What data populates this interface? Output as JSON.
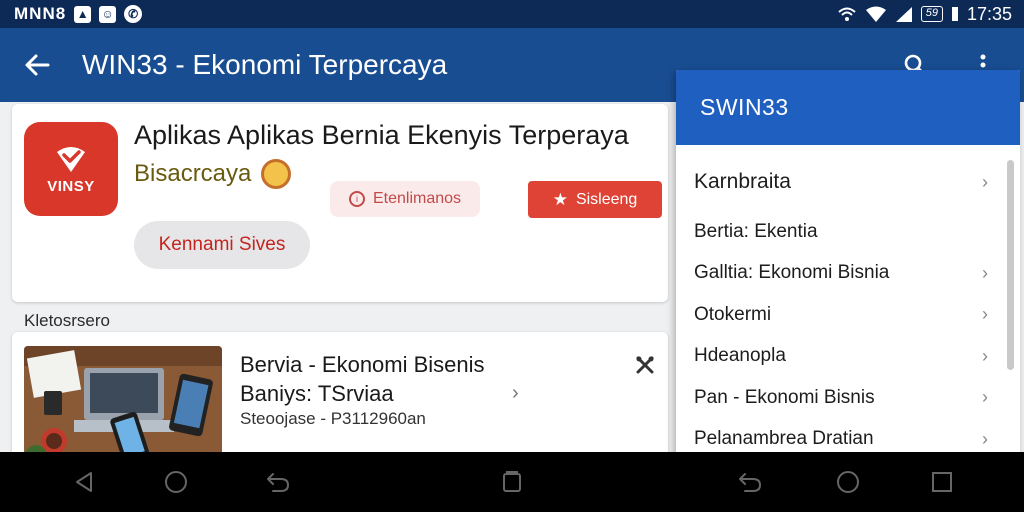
{
  "status_bar": {
    "carrier": "MNN8",
    "time": "17:35",
    "battery": "59",
    "left_icons": [
      "image-icon",
      "game-icon",
      "whatsapp-icon"
    ],
    "right_icons": [
      "wifi-calling-icon",
      "wifi-icon",
      "signal-icon",
      "battery-icon"
    ]
  },
  "app_bar": {
    "title": "WIN33 - Ekonomi Terpercaya",
    "icons": [
      "back-arrow-icon",
      "search-icon",
      "more-vert-icon"
    ]
  },
  "app_card": {
    "logo_text": "VINSY",
    "name": "Aplikas Aplikas Bernia Ekenyis Terperaya",
    "developer": "Bisacrcaya",
    "secondary_button": "Etenlimanos",
    "primary_button": "Sisleeng",
    "chip_button": "Kennami Sives"
  },
  "section_label": "Kletosrsero",
  "result": {
    "title": "Bervia - Ekonomi Bisenis",
    "subtitle": "Baniys: TSrviaa",
    "meta": "Steoojase - P3112960an"
  },
  "dropdown": {
    "header": "SWIN33",
    "items": [
      {
        "label": "Karnbraita",
        "chevron": true
      },
      {
        "label": "Bertia: Ekentia",
        "chevron": false
      },
      {
        "label": "Galltia: Ekonomi Bisnia",
        "chevron": true
      },
      {
        "label": "Otokermi",
        "chevron": true
      },
      {
        "label": "Hdeanopla",
        "chevron": true
      },
      {
        "label": "Pan - Ekonomi Bisnis",
        "chevron": true
      },
      {
        "label": "Pelanambrea Dratian",
        "chevron": true
      }
    ]
  },
  "nav_bar": {
    "buttons": [
      "back-icon",
      "home-icon",
      "undo-icon",
      "recents-icon",
      "back-icon",
      "home-icon",
      "square-icon"
    ]
  },
  "colors": {
    "status_bar": "#0d2a57",
    "app_bar": "#194d92",
    "dropdown_header": "#1f5fbf",
    "accent_red": "#df4336"
  }
}
